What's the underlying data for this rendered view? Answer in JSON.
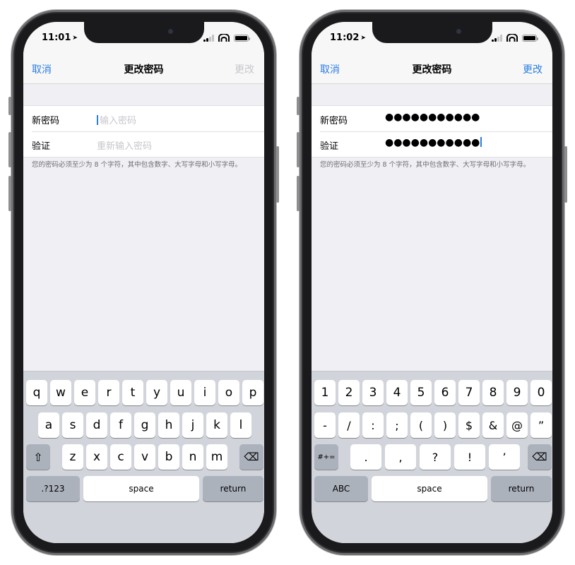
{
  "left": {
    "status": {
      "time": "11:01"
    },
    "nav": {
      "cancel": "取消",
      "title": "更改密码",
      "change": "更改"
    },
    "form": {
      "new_label": "新密码",
      "new_placeholder": "输入密码",
      "verify_label": "验证",
      "verify_placeholder": "重新输入密码"
    },
    "footnote": "您的密码必须至少为 8 个字符，其中包含数字、大写字母和小写字母。",
    "keyboard": {
      "row1": [
        "q",
        "w",
        "e",
        "r",
        "t",
        "y",
        "u",
        "i",
        "o",
        "p"
      ],
      "row2": [
        "a",
        "s",
        "d",
        "f",
        "g",
        "h",
        "j",
        "k",
        "l"
      ],
      "row3": [
        "z",
        "x",
        "c",
        "v",
        "b",
        "n",
        "m"
      ],
      "shift_icon": "shift-icon",
      "backspace_icon": "backspace-icon",
      "mode": ".?123",
      "space": "space",
      "return": "return"
    }
  },
  "right": {
    "status": {
      "time": "11:02"
    },
    "nav": {
      "cancel": "取消",
      "title": "更改密码",
      "change": "更改"
    },
    "form": {
      "new_label": "新密码",
      "new_value": "●●●●●●●●●●●",
      "verify_label": "验证",
      "verify_value": "●●●●●●●●●●●"
    },
    "footnote": "您的密码必须至少为 8 个字符，其中包含数字、大写字母和小写字母。",
    "keyboard": {
      "row1": [
        "1",
        "2",
        "3",
        "4",
        "5",
        "6",
        "7",
        "8",
        "9",
        "0"
      ],
      "row2": [
        "-",
        "/",
        ":",
        ";",
        "(",
        ")",
        "$",
        "&",
        "@",
        "”"
      ],
      "row3": [
        ".",
        ",",
        "?",
        "!",
        "’"
      ],
      "mode_toggle": "#+=",
      "backspace_icon": "backspace-icon",
      "mode": "ABC",
      "space": "space",
      "return": "return"
    }
  },
  "colors": {
    "accent": "#2a7de1",
    "disabled": "#c7c7cc",
    "background": "#efeff4",
    "keyboard": "#d1d4da"
  }
}
